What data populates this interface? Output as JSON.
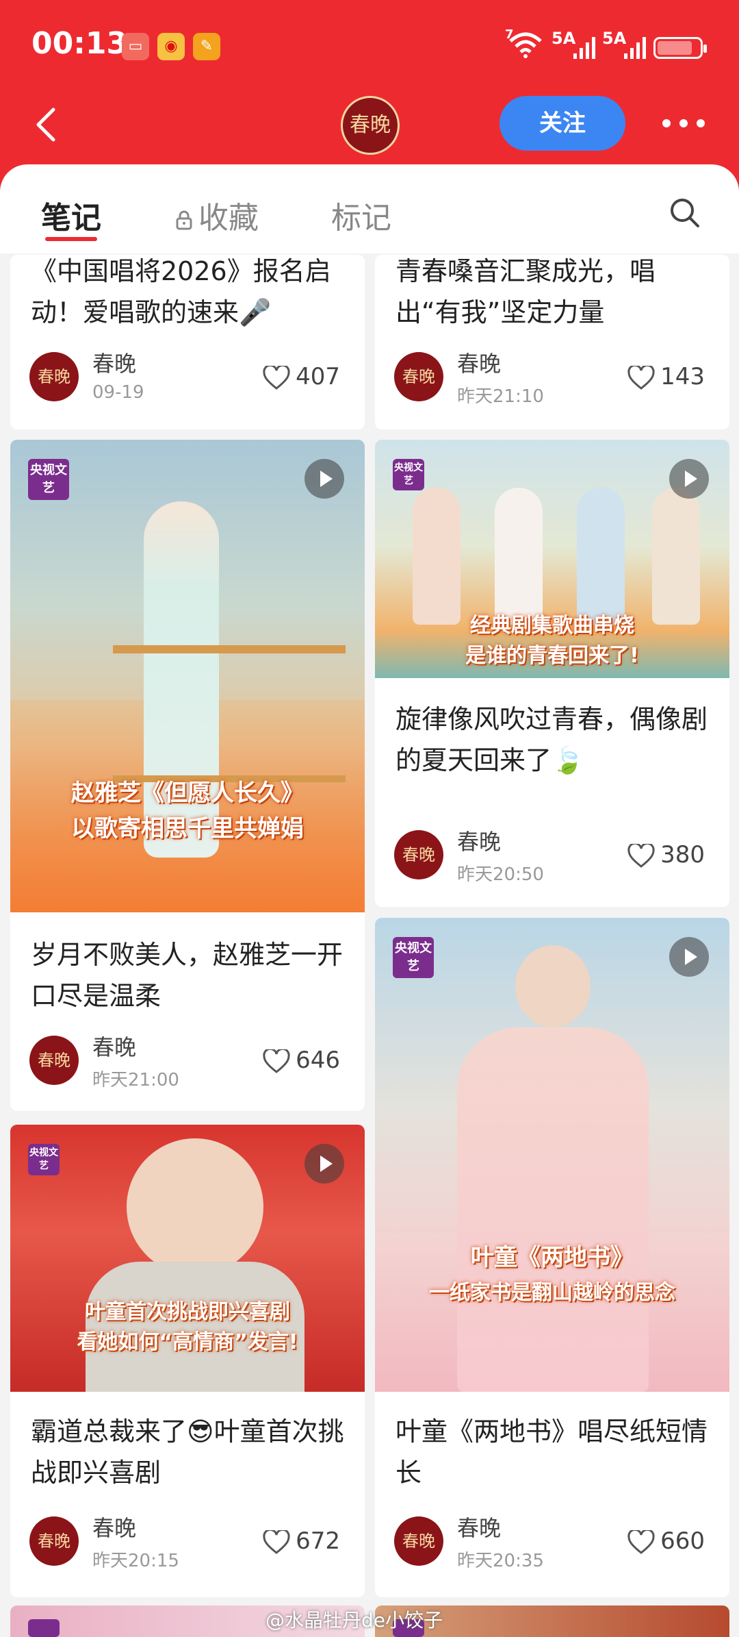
{
  "status": {
    "time": "00:13",
    "signal1": "5A",
    "signal2": "5A",
    "wifi": "7"
  },
  "header": {
    "brand": "春晚",
    "follow_label": "关注"
  },
  "tabs": [
    {
      "label": "笔记"
    },
    {
      "label": "收藏"
    },
    {
      "label": "标记"
    }
  ],
  "cards": [
    {
      "title": "《中国唱将2026》报名启动！爱唱歌的速来🎤",
      "author": "春晚",
      "date": "09-19",
      "likes": "407"
    },
    {
      "title": "青春嗓音汇聚成光，唱出“有我”坚定力量",
      "author": "春晚",
      "date": "昨天21:10",
      "likes": "143"
    },
    {
      "title": "岁月不败美人，赵雅芝一开口尽是温柔",
      "author": "春晚",
      "date": "昨天21:00",
      "likes": "646",
      "caption": [
        "赵雅芝《但愿人长久》",
        "以歌寄相思千里共婵娟"
      ]
    },
    {
      "title": "旋律像风吹过青春，偶像剧的夏天回来了🍃",
      "author": "春晚",
      "date": "昨天20:50",
      "likes": "380",
      "caption": [
        "经典剧集歌曲串烧",
        "是谁的青春回来了!"
      ]
    },
    {
      "title": "霸道总裁来了😎叶童首次挑战即兴喜剧",
      "author": "春晚",
      "date": "昨天20:15",
      "likes": "672",
      "caption": [
        "叶童首次挑战即兴喜剧",
        "看她如何“高情商”发言!"
      ]
    },
    {
      "title": "叶童《两地书》唱尽纸短情长",
      "author": "春晚",
      "date": "昨天20:35",
      "likes": "660",
      "caption": [
        "叶童《两地书》",
        "一纸家书是翻山越岭的思念"
      ]
    }
  ],
  "badge": "央视文艺",
  "watermark": "@水晶牡丹de小饺子",
  "colors": {
    "brand_red": "#ee2a31",
    "follow_blue": "#3c86f3",
    "avatar": "#8b1419"
  }
}
